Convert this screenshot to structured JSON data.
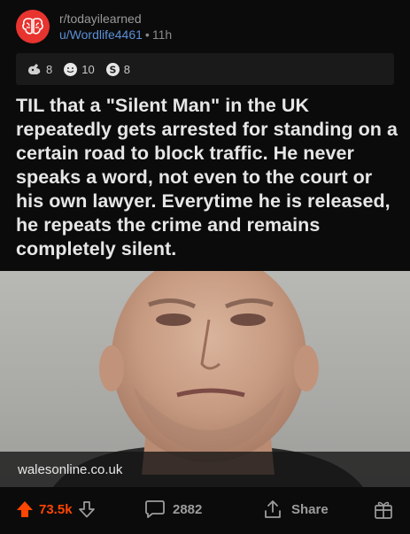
{
  "post": {
    "subreddit": "r/todayilearned",
    "author": "u/Wordlife4461",
    "separator": "•",
    "age": "11h",
    "awards": [
      {
        "icon": "helpful-award-icon",
        "count": "8"
      },
      {
        "icon": "wholesome-award-icon",
        "count": "10"
      },
      {
        "icon": "silver-award-icon",
        "count": "8"
      }
    ],
    "title": "TIL that a \"Silent Man\" in the UK repeatedly gets arrested for standing on a certain road to block traffic. He never speaks a word, not even to the court or his own lawyer. Everytime he is released, he repeats the crime and remains completely silent.",
    "link_domain": "walesonline.co.uk"
  },
  "actions": {
    "score": "73.5k",
    "comments": "2882",
    "share_label": "Share"
  },
  "colors": {
    "upvote": "#ff4500",
    "subreddit_avatar": "#e8342f",
    "username": "#5a8fd6",
    "background": "#0b0b0b"
  }
}
